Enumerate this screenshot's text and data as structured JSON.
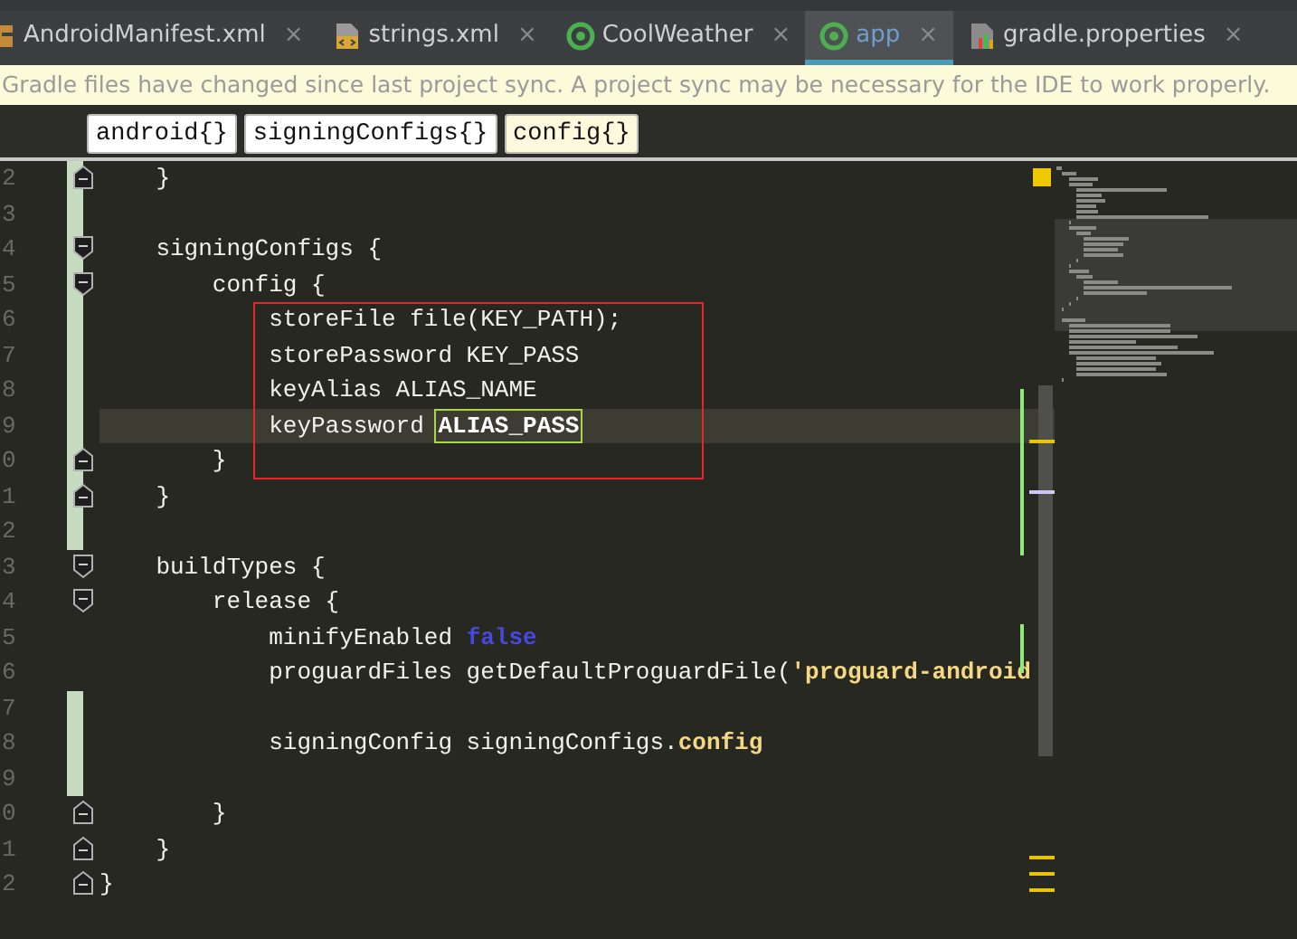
{
  "tabs": [
    {
      "label": "AndroidManifest.xml",
      "kind": "xml",
      "selected": false
    },
    {
      "label": "strings.xml",
      "kind": "resource",
      "selected": false
    },
    {
      "label": "CoolWeather",
      "kind": "module",
      "selected": false
    },
    {
      "label": "app",
      "kind": "module",
      "selected": true
    },
    {
      "label": "gradle.properties",
      "kind": "properties",
      "selected": false
    }
  ],
  "close_glyph": "×",
  "notification": "Gradle files have changed since last project sync. A project sync may be necessary for the IDE to work properly.",
  "breadcrumbs": [
    {
      "label": "android{}",
      "selected": false
    },
    {
      "label": "signingConfigs{}",
      "selected": false
    },
    {
      "label": "config{}",
      "selected": true
    }
  ],
  "editor": {
    "lines": [
      {
        "children": [
          {
            "number": "2",
            "changed": true,
            "kind": "fold-end",
            "current": false,
            "boxed": false,
            "tokens": [
              {
                "text": "}",
                "kind": "plain"
              }
            ]
          },
          {
            "number": "3",
            "changed": true,
            "current": false,
            "boxed": false
          },
          {
            "number": "4",
            "changed": true,
            "kind": "fold-start",
            "current": false,
            "boxed": false,
            "tokens": [
              {
                "text": "signingConfigs {",
                "kind": "plain"
              }
            ],
            "children": [
              {
                "number": "5",
                "changed": true,
                "kind": "fold-start",
                "current": false,
                "boxed": false,
                "tokens": [
                  {
                    "text": "config {",
                    "kind": "plain"
                  }
                ],
                "children": [
                  {
                    "number": "6",
                    "changed": true,
                    "current": false,
                    "boxed": true,
                    "tokens": [
                      {
                        "text": "storeFile file(KEY_PATH);",
                        "kind": "plain"
                      }
                    ]
                  },
                  {
                    "number": "7",
                    "changed": true,
                    "current": false,
                    "boxed": true,
                    "tokens": [
                      {
                        "text": "storePassword KEY_PASS",
                        "kind": "plain"
                      }
                    ]
                  },
                  {
                    "number": "8",
                    "changed": true,
                    "current": false,
                    "boxed": true,
                    "tokens": [
                      {
                        "text": "keyAlias ALIAS_NAME",
                        "kind": "plain"
                      }
                    ]
                  },
                  {
                    "number": "9",
                    "changed": true,
                    "current": true,
                    "boxed": true,
                    "tokens": [
                      {
                        "text": "keyPassword ",
                        "kind": "plain"
                      },
                      {
                        "text": "ALIAS_PASS",
                        "kind": "match"
                      }
                    ]
                  }
                ]
              },
              {
                "number": "0",
                "changed": true,
                "kind": "fold-end",
                "current": false,
                "boxed": true,
                "tokens": [
                  {
                    "text": "}",
                    "kind": "plain"
                  }
                ]
              }
            ]
          },
          {
            "number": "1",
            "changed": true,
            "kind": "fold-end",
            "current": false,
            "boxed": false,
            "tokens": [
              {
                "text": "}",
                "kind": "plain"
              }
            ]
          },
          {
            "number": "2",
            "changed": true,
            "current": false,
            "boxed": false
          },
          {
            "number": "3",
            "changed": false,
            "kind": "fold-start",
            "current": false,
            "boxed": false,
            "tokens": [
              {
                "text": "buildTypes {",
                "kind": "plain"
              }
            ],
            "children": [
              {
                "number": "4",
                "changed": false,
                "kind": "fold-start",
                "current": false,
                "boxed": false,
                "tokens": [
                  {
                    "text": "release {",
                    "kind": "plain"
                  }
                ],
                "children": [
                  {
                    "number": "5",
                    "changed": false,
                    "current": false,
                    "boxed": false,
                    "tokens": [
                      {
                        "text": "minifyEnabled ",
                        "kind": "plain"
                      },
                      {
                        "text": "false",
                        "kind": "keyword"
                      }
                    ]
                  },
                  {
                    "number": "6",
                    "changed": false,
                    "current": false,
                    "boxed": false,
                    "tokens": [
                      {
                        "text": "proguardFiles getDefaultProguardFile(",
                        "kind": "plain"
                      },
                      {
                        "text": "'proguard-android",
                        "kind": "string"
                      }
                    ]
                  },
                  {
                    "number": "7",
                    "changed": true,
                    "current": false,
                    "boxed": false
                  },
                  {
                    "number": "8",
                    "changed": true,
                    "current": false,
                    "boxed": false,
                    "tokens": [
                      {
                        "text": "signingConfig signingConfigs.",
                        "kind": "plain"
                      },
                      {
                        "text": "config",
                        "kind": "property"
                      }
                    ]
                  },
                  {
                    "number": "9",
                    "changed": true,
                    "current": false,
                    "boxed": false
                  }
                ]
              },
              {
                "number": "0",
                "changed": false,
                "kind": "fold-end",
                "current": false,
                "boxed": false,
                "tokens": [
                  {
                    "text": "}",
                    "kind": "plain"
                  }
                ]
              }
            ]
          },
          {
            "number": "1",
            "changed": false,
            "kind": "fold-end",
            "current": false,
            "boxed": false,
            "tokens": [
              {
                "text": "}",
                "kind": "plain"
              }
            ]
          }
        ]
      },
      {
        "number": "2",
        "changed": false,
        "kind": "fold-end",
        "current": false,
        "boxed": false,
        "tokens": [
          {
            "text": "}",
            "kind": "plain"
          }
        ]
      }
    ]
  }
}
